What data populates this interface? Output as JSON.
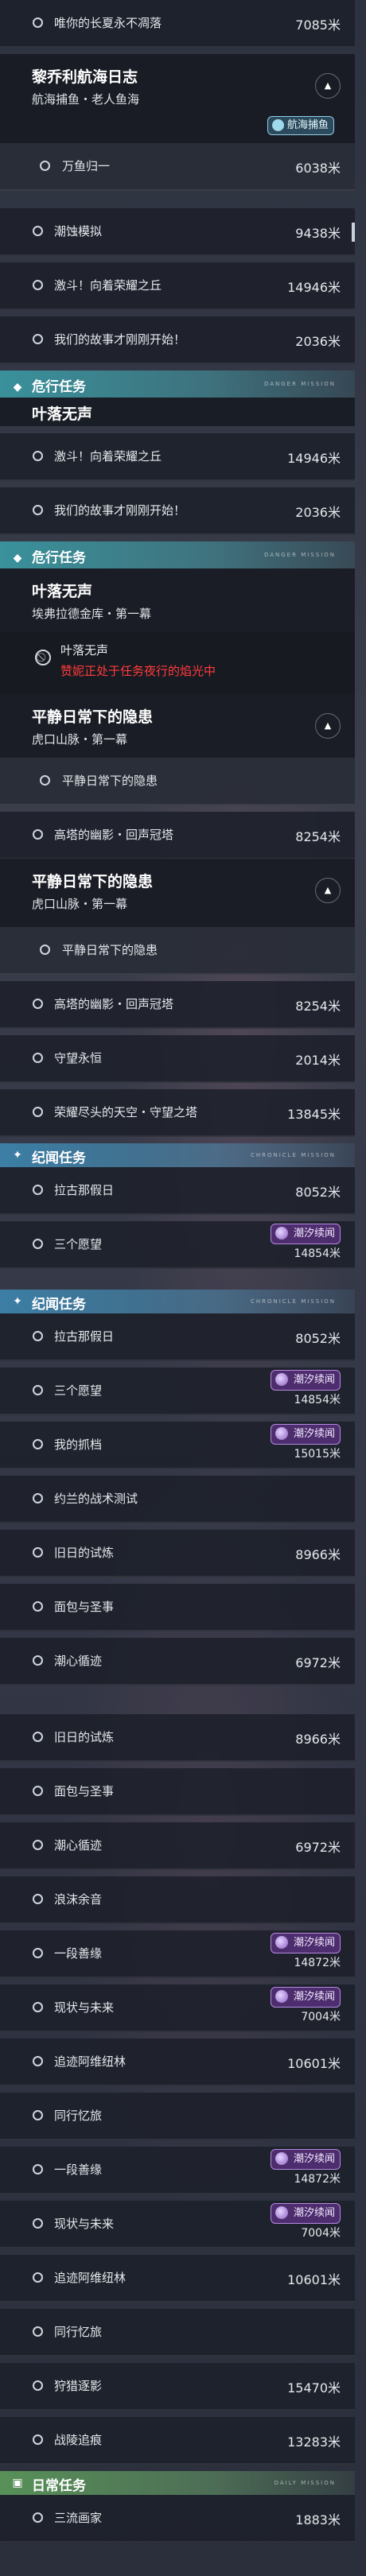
{
  "panel1": {
    "top_row": {
      "name": "唯你的长夏永不凋落",
      "distance": "7085米"
    },
    "journal": {
      "title": "黎乔利航海日志",
      "subtitle": "航海捕鱼・老人鱼海",
      "badge": "航海捕鱼"
    },
    "child": {
      "name": "万鱼归一",
      "distance": "6038米"
    },
    "rows": [
      {
        "name": "潮蚀模拟",
        "distance": "9438米"
      },
      {
        "name": "激斗！向着荣耀之丘",
        "distance": "14946米"
      },
      {
        "name": "我们的故事才刚刚开始！",
        "distance": "2036米"
      }
    ],
    "header": {
      "title": "危行任务",
      "sub": "DANGER MISSION"
    },
    "peek_title": "叶落无声"
  },
  "panel2": {
    "rows": [
      {
        "name": "激斗！向着荣耀之丘",
        "distance": "14946米"
      },
      {
        "name": "我们的故事才刚刚开始！",
        "distance": "2036米"
      }
    ],
    "header": {
      "title": "危行任务",
      "sub": "DANGER MISSION"
    },
    "quest": {
      "title": "叶落无声",
      "subtitle": "埃弗拉德金库・第一幕"
    },
    "warning": {
      "name": "叶落无声",
      "message": "赞妮正处于任务夜行的焰光中"
    },
    "quest2": {
      "title": "平静日常下的隐患",
      "subtitle": "虎口山脉・第一幕"
    },
    "child": {
      "name": "平静日常下的隐患"
    },
    "row_after": {
      "name": "高塔的幽影・回声冠塔",
      "distance": "8254米"
    }
  },
  "panel3": {
    "quest": {
      "title": "平静日常下的隐患",
      "subtitle": "虎口山脉・第一幕"
    },
    "child": {
      "name": "平静日常下的隐患"
    },
    "rows": [
      {
        "name": "高塔的幽影・回声冠塔",
        "distance": "8254米"
      },
      {
        "name": "守望永恒",
        "distance": "2014米"
      },
      {
        "name": "荣耀尽头的天空・守望之塔",
        "distance": "13845米"
      }
    ],
    "header": {
      "title": "纪闻任务",
      "sub": "CHRONICLE MISSION"
    },
    "rows2": [
      {
        "name": "拉古那假日",
        "distance": "8052米"
      },
      {
        "name": "三个愿望",
        "distance": "14854米",
        "tag": "潮汐续闻"
      }
    ]
  },
  "panel4": {
    "header": {
      "title": "纪闻任务",
      "sub": "CHRONICLE MISSION"
    },
    "rows": [
      {
        "name": "拉古那假日",
        "distance": "8052米"
      },
      {
        "name": "三个愿望",
        "distance": "14854米",
        "tag": "潮汐续闻"
      },
      {
        "name": "我的抓档",
        "distance": "15015米",
        "tag": "潮汐续闻"
      },
      {
        "name": "约兰的战术测试",
        "distance": ""
      },
      {
        "name": "旧日的试炼",
        "distance": "8966米"
      },
      {
        "name": "面包与圣事",
        "distance": ""
      },
      {
        "name": "潮心循迹",
        "distance": "6972米"
      }
    ]
  },
  "panel5": {
    "rows": [
      {
        "name": "旧日的试炼",
        "distance": "8966米"
      },
      {
        "name": "面包与圣事",
        "distance": ""
      },
      {
        "name": "潮心循迹",
        "distance": "6972米"
      },
      {
        "name": "浪沫余音",
        "distance": ""
      },
      {
        "name": "一段善缘",
        "distance": "14872米",
        "tag": "潮汐续闻"
      },
      {
        "name": "现状与未来",
        "distance": "7004米",
        "tag": "潮汐续闻"
      },
      {
        "name": "追迹阿维纽林",
        "distance": "10601米"
      },
      {
        "name": "同行忆旅",
        "distance": ""
      }
    ]
  },
  "panel6": {
    "rows": [
      {
        "name": "一段善缘",
        "distance": "14872米",
        "tag": "潮汐续闻"
      },
      {
        "name": "现状与未来",
        "distance": "7004米",
        "tag": "潮汐续闻"
      },
      {
        "name": "追迹阿维纽林",
        "distance": "10601米"
      },
      {
        "name": "同行忆旅",
        "distance": ""
      },
      {
        "name": "狩猎逐影",
        "distance": "15470米"
      },
      {
        "name": "战陵追痕",
        "distance": "13283米"
      }
    ],
    "header": {
      "title": "日常任务",
      "sub": "DAILY MISSION"
    },
    "rows2": [
      {
        "name": "三流画家",
        "distance": "1883米"
      }
    ]
  },
  "colors": {
    "accent_teal": "#3a96a0",
    "warning_red": "#ff3b3b",
    "tag_purple": "#4d2d6e"
  }
}
